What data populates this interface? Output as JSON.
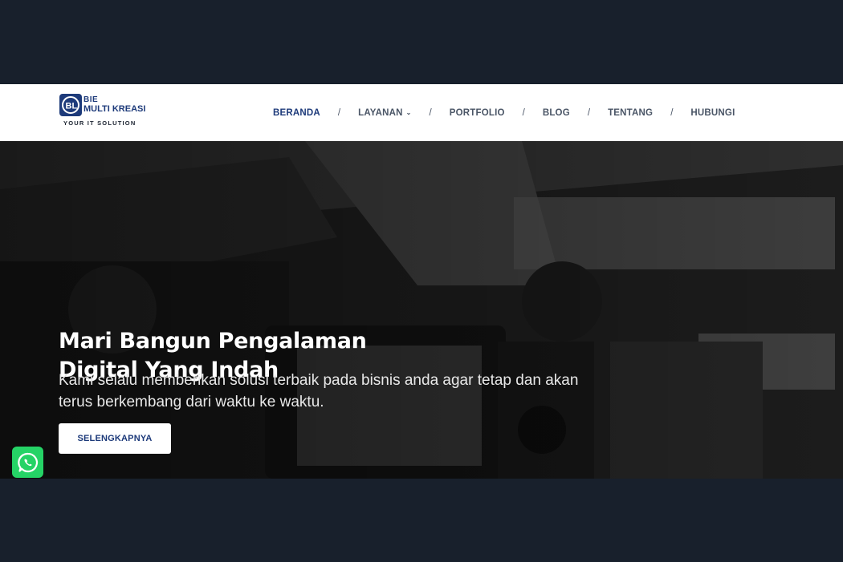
{
  "brand": {
    "line1": "BIE",
    "line2": "MULTI KREASI",
    "tagline": "YOUR IT SOLUTION",
    "primary_color": "#1d3a7a"
  },
  "nav": {
    "separator": "/",
    "items": [
      {
        "label": "BERANDA",
        "active": true
      },
      {
        "label": "LAYANAN",
        "has_dropdown": true
      },
      {
        "label": "PORTFOLIO"
      },
      {
        "label": "BLOG"
      },
      {
        "label": "TENTANG"
      },
      {
        "label": "HUBUNGI"
      }
    ]
  },
  "hero": {
    "title_line1": "Mari Bangun Pengalaman",
    "title_line2": "Digital Yang Indah",
    "subtitle": "Kami selalu memberikan solusi terbaik pada bisnis anda agar tetap dan akan terus berkembang dari waktu ke waktu.",
    "cta_label": "SELENGKAPNYA"
  },
  "floating": {
    "whatsapp_icon": "whatsapp-icon",
    "whatsapp_color": "#25d366"
  }
}
